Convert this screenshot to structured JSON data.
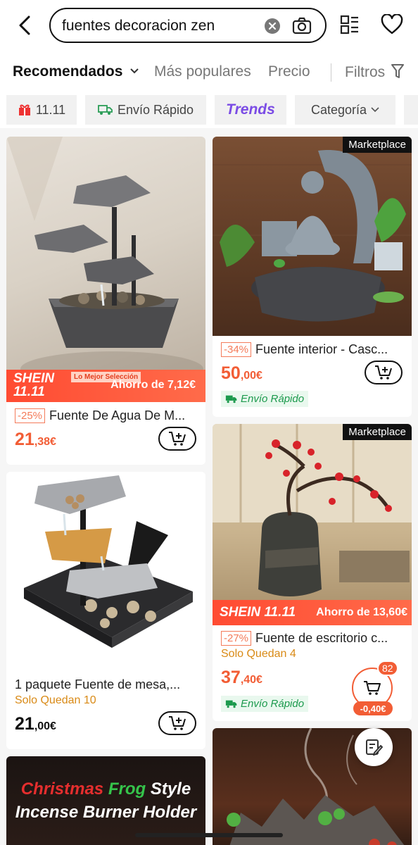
{
  "search": {
    "query": "fuentes decoracion zen",
    "placeholder": ""
  },
  "sort_tabs": [
    {
      "label": "Recomendados"
    },
    {
      "label": "Más populares"
    },
    {
      "label": "Precio"
    }
  ],
  "filters_label": "Filtros",
  "chips": [
    {
      "label": "11.11",
      "icon": "gift-icon"
    },
    {
      "label": "Envío Rápido",
      "icon": "truck-icon"
    },
    {
      "label": "Trends",
      "icon": ""
    },
    {
      "label": "Categoría",
      "icon": "chevron-down-icon"
    }
  ],
  "products": [
    {
      "discount": "-25%",
      "title": "Fuente De Agua De M...",
      "price_main": "21",
      "price_cents": ",38€",
      "price_color": "#f25d35",
      "promo": {
        "brand_line1": "SHEIN",
        "brand_line2": "11.11",
        "tag": "Lo Mejor Selección",
        "saving": "Ahorro de 7,12€"
      }
    },
    {
      "badge": "Marketplace",
      "discount": "-34%",
      "title": "Fuente interior - Casc...",
      "price_main": "50",
      "price_cents": ",00€",
      "price_color": "#f25d35",
      "shipping": "Envío Rápido"
    },
    {
      "title": "1 paquete Fuente de mesa,...",
      "stock": "Solo Quedan  10",
      "price_main": "21",
      "price_cents": ",00€",
      "price_color": "#111111"
    },
    {
      "badge": "Marketplace",
      "discount": "-27%",
      "title": "Fuente de escritorio c...",
      "stock": "Solo Quedan  4",
      "price_main": "37",
      "price_cents": ",40€",
      "price_color": "#f25d35",
      "shipping": "Envío Rápido",
      "promo": {
        "brand_line1": "SHEIN 11.11",
        "saving": "Ahorro de 13,60€"
      },
      "cart_count": "82",
      "cart_saving": "-0,40€"
    },
    {
      "banner_line1_a": "Christmas",
      "banner_line1_b": "Frog",
      "banner_line1_c": "Style",
      "banner_line2": "Incense Burner Holder"
    }
  ],
  "colors": {
    "accent": "#f25d35",
    "green": "#1c9a4d",
    "stock": "#d98a16",
    "purple": "#7b4ce5"
  }
}
